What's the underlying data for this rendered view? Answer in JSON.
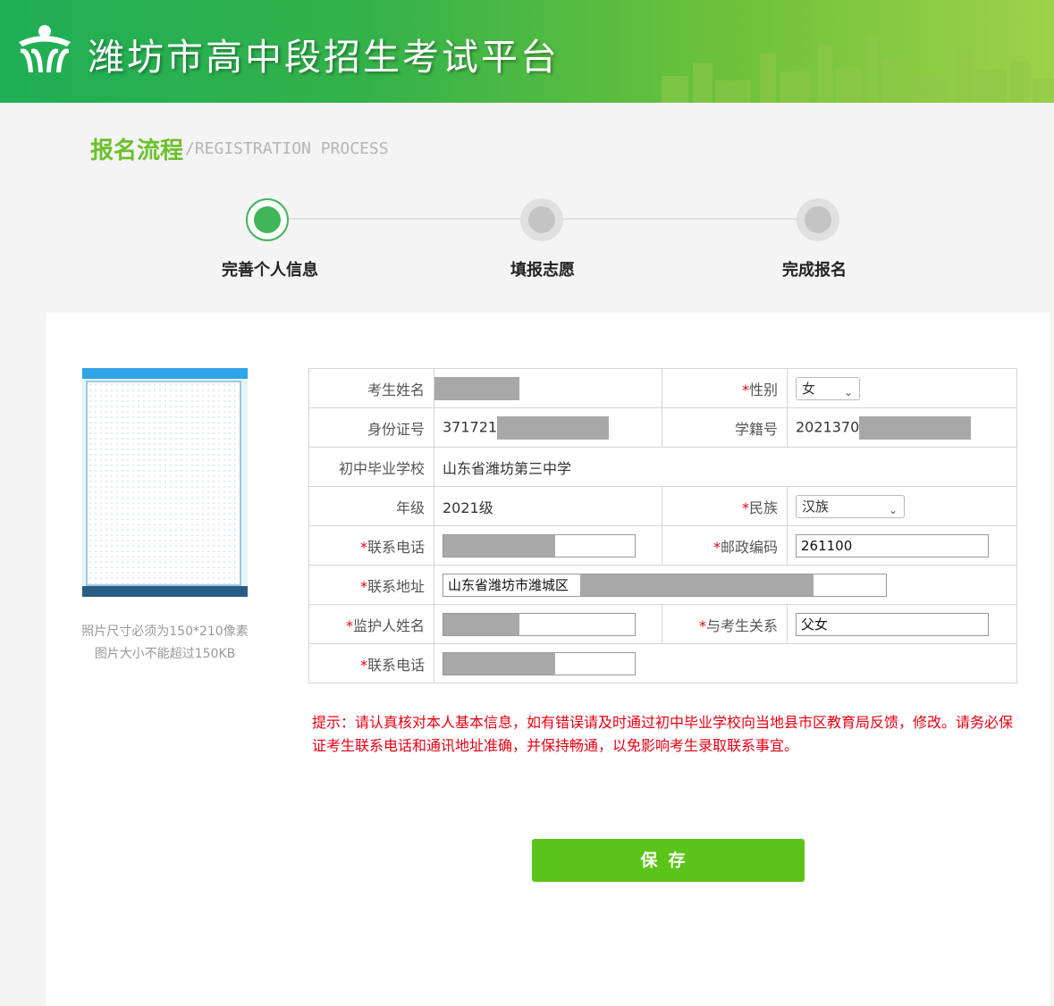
{
  "header": {
    "site_title": "潍坊市高中段招生考试平台"
  },
  "process": {
    "title": "报名流程",
    "subtitle": "/REGISTRATION PROCESS",
    "steps": [
      {
        "label": "完善个人信息",
        "active": true
      },
      {
        "label": "填报志愿",
        "active": false
      },
      {
        "label": "完成报名",
        "active": false
      }
    ]
  },
  "photo": {
    "note_line1": "照片尺寸必须为150*210像素",
    "note_line2": "图片大小不能超过150KB"
  },
  "form": {
    "name_label": "考生姓名",
    "gender_label": "性别",
    "gender_value": "女",
    "id_label": "身份证号",
    "id_prefix": "371721",
    "student_no_label": "学籍号",
    "student_no_prefix": "2021370",
    "school_label": "初中毕业学校",
    "school_value": "山东省潍坊第三中学",
    "grade_label": "年级",
    "grade_value": "2021级",
    "ethnicity_label": "民族",
    "ethnicity_value": "汉族",
    "phone_label": "联系电话",
    "postcode_label": "邮政编码",
    "postcode_value": "261100",
    "address_label": "联系地址",
    "address_value": "山东省潍坊市潍城区",
    "guardian_label": "监护人姓名",
    "relation_label": "与考生关系",
    "relation_value": "父女",
    "guardian_phone_label": "联系电话",
    "required_mark": "*"
  },
  "tip": "提示：请认真核对本人基本信息，如有错误请及时通过初中毕业学校向当地县市区教育局反馈，修改。请务必保证考生联系电话和通讯地址准确，并保持畅通，以免影响考生录取联系事宜。",
  "actions": {
    "save_label": "保存"
  },
  "colors": {
    "brand_green": "#6cc02d",
    "button_green": "#5bc418",
    "tip_red": "#e60012",
    "active_step": "#41b55a"
  }
}
